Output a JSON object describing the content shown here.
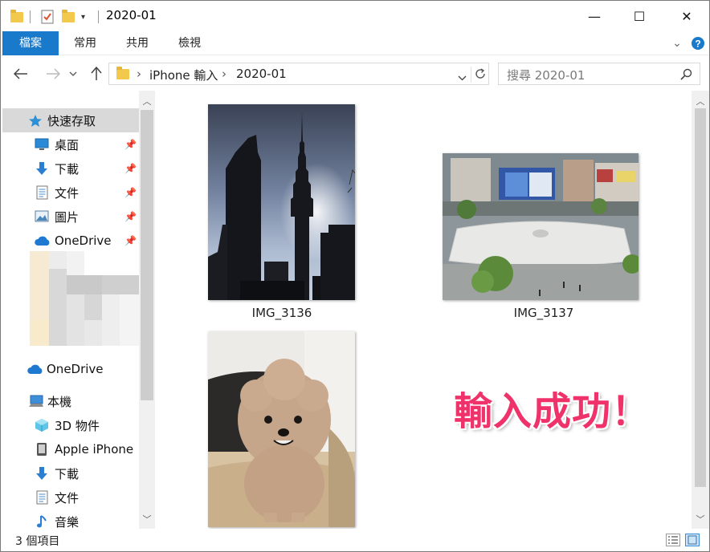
{
  "window": {
    "title": "2020-01",
    "minimize_glyph": "—",
    "maximize_glyph": "☐",
    "close_glyph": "✕"
  },
  "ribbon": {
    "tabs": [
      {
        "label": "檔案",
        "active": true
      },
      {
        "label": "常用"
      },
      {
        "label": "共用"
      },
      {
        "label": "檢視"
      }
    ],
    "expand_glyph": "⌄",
    "help_glyph": "?"
  },
  "address": {
    "segments": [
      "iPhone 輸入",
      "2020-01"
    ],
    "search_placeholder": "搜尋 2020-01"
  },
  "navigation": {
    "quick_access": "快速存取",
    "pinned": [
      {
        "label": "桌面",
        "icon": "desktop-icon"
      },
      {
        "label": "下載",
        "icon": "download-arrow-icon"
      },
      {
        "label": "文件",
        "icon": "document-icon"
      },
      {
        "label": "圖片",
        "icon": "pictures-icon"
      },
      {
        "label": "OneDrive",
        "icon": "onedrive-cloud-icon"
      }
    ],
    "onedrive": "OneDrive",
    "this_pc": "本機",
    "pc_items": [
      {
        "label": "3D 物件",
        "icon": "3d-objects-icon"
      },
      {
        "label": "Apple iPhone",
        "icon": "iphone-device-icon"
      },
      {
        "label": "下載",
        "icon": "download-arrow-icon"
      },
      {
        "label": "文件",
        "icon": "document-icon"
      },
      {
        "label": "音樂",
        "icon": "music-note-icon"
      }
    ]
  },
  "files": [
    {
      "name": "IMG_3136"
    },
    {
      "name": "IMG_3137"
    },
    {
      "name": ""
    }
  ],
  "callout": "輸入成功！",
  "status": {
    "item_count": "3 個項目"
  },
  "colors": {
    "accent": "#1979ca",
    "callout": "#f0326a",
    "selected_nav": "#d9d9d9"
  }
}
